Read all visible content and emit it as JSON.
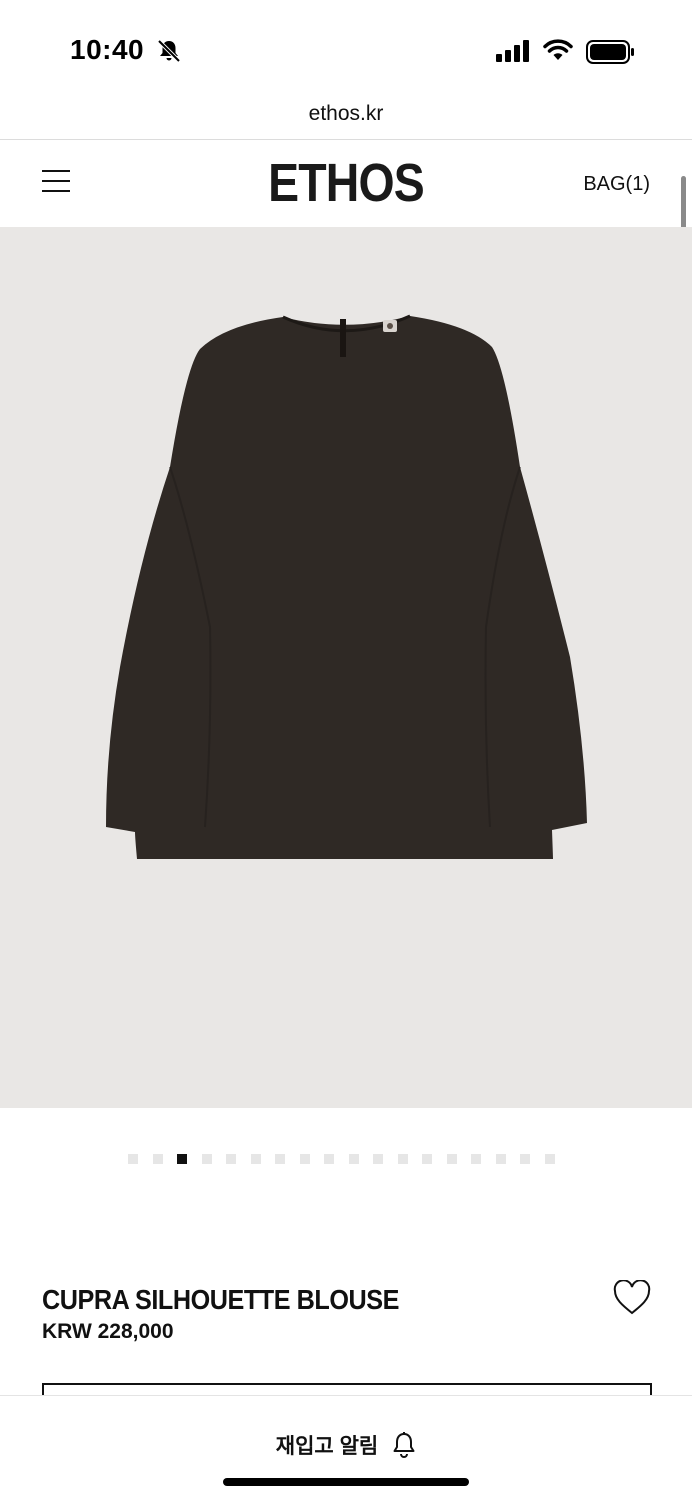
{
  "status_bar": {
    "time": "10:40",
    "icons": [
      "bell-slash-icon",
      "cellular-signal-icon",
      "wifi-icon",
      "battery-icon"
    ]
  },
  "browser": {
    "url": "ethos.kr"
  },
  "header": {
    "logo": "ETHOS",
    "bag_label": "BAG(1)",
    "menu_icon": "hamburger-menu-icon"
  },
  "gallery": {
    "image_alt": "dark brown long-sleeve blouse",
    "total_images": 18,
    "active_index": 2
  },
  "product": {
    "name": "CUPRA SILHOUETTE BLOUSE",
    "price": "KRW 228,000",
    "wishlist_icon": "heart-outline-icon"
  },
  "bottom_bar": {
    "restock_label": "재입고 알림",
    "restock_icon": "bell-icon"
  },
  "colors": {
    "hero_bg": "#e9e7e5",
    "garment": "#2f2925",
    "text": "#111111"
  }
}
